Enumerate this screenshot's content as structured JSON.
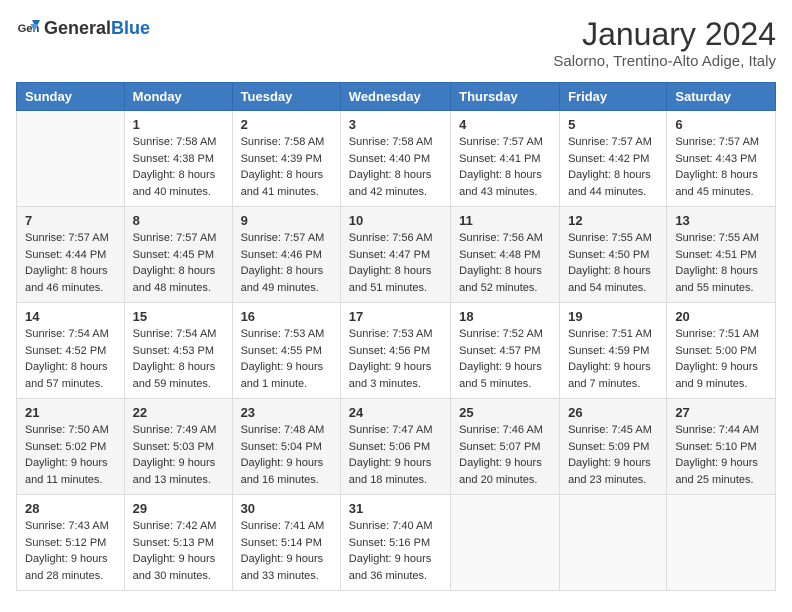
{
  "header": {
    "logo_general": "General",
    "logo_blue": "Blue",
    "month": "January 2024",
    "location": "Salorno, Trentino-Alto Adige, Italy"
  },
  "days_of_week": [
    "Sunday",
    "Monday",
    "Tuesday",
    "Wednesday",
    "Thursday",
    "Friday",
    "Saturday"
  ],
  "weeks": [
    [
      {
        "day": "",
        "sunrise": "",
        "sunset": "",
        "daylight": ""
      },
      {
        "day": "1",
        "sunrise": "Sunrise: 7:58 AM",
        "sunset": "Sunset: 4:38 PM",
        "daylight": "Daylight: 8 hours and 40 minutes."
      },
      {
        "day": "2",
        "sunrise": "Sunrise: 7:58 AM",
        "sunset": "Sunset: 4:39 PM",
        "daylight": "Daylight: 8 hours and 41 minutes."
      },
      {
        "day": "3",
        "sunrise": "Sunrise: 7:58 AM",
        "sunset": "Sunset: 4:40 PM",
        "daylight": "Daylight: 8 hours and 42 minutes."
      },
      {
        "day": "4",
        "sunrise": "Sunrise: 7:57 AM",
        "sunset": "Sunset: 4:41 PM",
        "daylight": "Daylight: 8 hours and 43 minutes."
      },
      {
        "day": "5",
        "sunrise": "Sunrise: 7:57 AM",
        "sunset": "Sunset: 4:42 PM",
        "daylight": "Daylight: 8 hours and 44 minutes."
      },
      {
        "day": "6",
        "sunrise": "Sunrise: 7:57 AM",
        "sunset": "Sunset: 4:43 PM",
        "daylight": "Daylight: 8 hours and 45 minutes."
      }
    ],
    [
      {
        "day": "7",
        "sunrise": "Sunrise: 7:57 AM",
        "sunset": "Sunset: 4:44 PM",
        "daylight": "Daylight: 8 hours and 46 minutes."
      },
      {
        "day": "8",
        "sunrise": "Sunrise: 7:57 AM",
        "sunset": "Sunset: 4:45 PM",
        "daylight": "Daylight: 8 hours and 48 minutes."
      },
      {
        "day": "9",
        "sunrise": "Sunrise: 7:57 AM",
        "sunset": "Sunset: 4:46 PM",
        "daylight": "Daylight: 8 hours and 49 minutes."
      },
      {
        "day": "10",
        "sunrise": "Sunrise: 7:56 AM",
        "sunset": "Sunset: 4:47 PM",
        "daylight": "Daylight: 8 hours and 51 minutes."
      },
      {
        "day": "11",
        "sunrise": "Sunrise: 7:56 AM",
        "sunset": "Sunset: 4:48 PM",
        "daylight": "Daylight: 8 hours and 52 minutes."
      },
      {
        "day": "12",
        "sunrise": "Sunrise: 7:55 AM",
        "sunset": "Sunset: 4:50 PM",
        "daylight": "Daylight: 8 hours and 54 minutes."
      },
      {
        "day": "13",
        "sunrise": "Sunrise: 7:55 AM",
        "sunset": "Sunset: 4:51 PM",
        "daylight": "Daylight: 8 hours and 55 minutes."
      }
    ],
    [
      {
        "day": "14",
        "sunrise": "Sunrise: 7:54 AM",
        "sunset": "Sunset: 4:52 PM",
        "daylight": "Daylight: 8 hours and 57 minutes."
      },
      {
        "day": "15",
        "sunrise": "Sunrise: 7:54 AM",
        "sunset": "Sunset: 4:53 PM",
        "daylight": "Daylight: 8 hours and 59 minutes."
      },
      {
        "day": "16",
        "sunrise": "Sunrise: 7:53 AM",
        "sunset": "Sunset: 4:55 PM",
        "daylight": "Daylight: 9 hours and 1 minute."
      },
      {
        "day": "17",
        "sunrise": "Sunrise: 7:53 AM",
        "sunset": "Sunset: 4:56 PM",
        "daylight": "Daylight: 9 hours and 3 minutes."
      },
      {
        "day": "18",
        "sunrise": "Sunrise: 7:52 AM",
        "sunset": "Sunset: 4:57 PM",
        "daylight": "Daylight: 9 hours and 5 minutes."
      },
      {
        "day": "19",
        "sunrise": "Sunrise: 7:51 AM",
        "sunset": "Sunset: 4:59 PM",
        "daylight": "Daylight: 9 hours and 7 minutes."
      },
      {
        "day": "20",
        "sunrise": "Sunrise: 7:51 AM",
        "sunset": "Sunset: 5:00 PM",
        "daylight": "Daylight: 9 hours and 9 minutes."
      }
    ],
    [
      {
        "day": "21",
        "sunrise": "Sunrise: 7:50 AM",
        "sunset": "Sunset: 5:02 PM",
        "daylight": "Daylight: 9 hours and 11 minutes."
      },
      {
        "day": "22",
        "sunrise": "Sunrise: 7:49 AM",
        "sunset": "Sunset: 5:03 PM",
        "daylight": "Daylight: 9 hours and 13 minutes."
      },
      {
        "day": "23",
        "sunrise": "Sunrise: 7:48 AM",
        "sunset": "Sunset: 5:04 PM",
        "daylight": "Daylight: 9 hours and 16 minutes."
      },
      {
        "day": "24",
        "sunrise": "Sunrise: 7:47 AM",
        "sunset": "Sunset: 5:06 PM",
        "daylight": "Daylight: 9 hours and 18 minutes."
      },
      {
        "day": "25",
        "sunrise": "Sunrise: 7:46 AM",
        "sunset": "Sunset: 5:07 PM",
        "daylight": "Daylight: 9 hours and 20 minutes."
      },
      {
        "day": "26",
        "sunrise": "Sunrise: 7:45 AM",
        "sunset": "Sunset: 5:09 PM",
        "daylight": "Daylight: 9 hours and 23 minutes."
      },
      {
        "day": "27",
        "sunrise": "Sunrise: 7:44 AM",
        "sunset": "Sunset: 5:10 PM",
        "daylight": "Daylight: 9 hours and 25 minutes."
      }
    ],
    [
      {
        "day": "28",
        "sunrise": "Sunrise: 7:43 AM",
        "sunset": "Sunset: 5:12 PM",
        "daylight": "Daylight: 9 hours and 28 minutes."
      },
      {
        "day": "29",
        "sunrise": "Sunrise: 7:42 AM",
        "sunset": "Sunset: 5:13 PM",
        "daylight": "Daylight: 9 hours and 30 minutes."
      },
      {
        "day": "30",
        "sunrise": "Sunrise: 7:41 AM",
        "sunset": "Sunset: 5:14 PM",
        "daylight": "Daylight: 9 hours and 33 minutes."
      },
      {
        "day": "31",
        "sunrise": "Sunrise: 7:40 AM",
        "sunset": "Sunset: 5:16 PM",
        "daylight": "Daylight: 9 hours and 36 minutes."
      },
      {
        "day": "",
        "sunrise": "",
        "sunset": "",
        "daylight": ""
      },
      {
        "day": "",
        "sunrise": "",
        "sunset": "",
        "daylight": ""
      },
      {
        "day": "",
        "sunrise": "",
        "sunset": "",
        "daylight": ""
      }
    ]
  ]
}
